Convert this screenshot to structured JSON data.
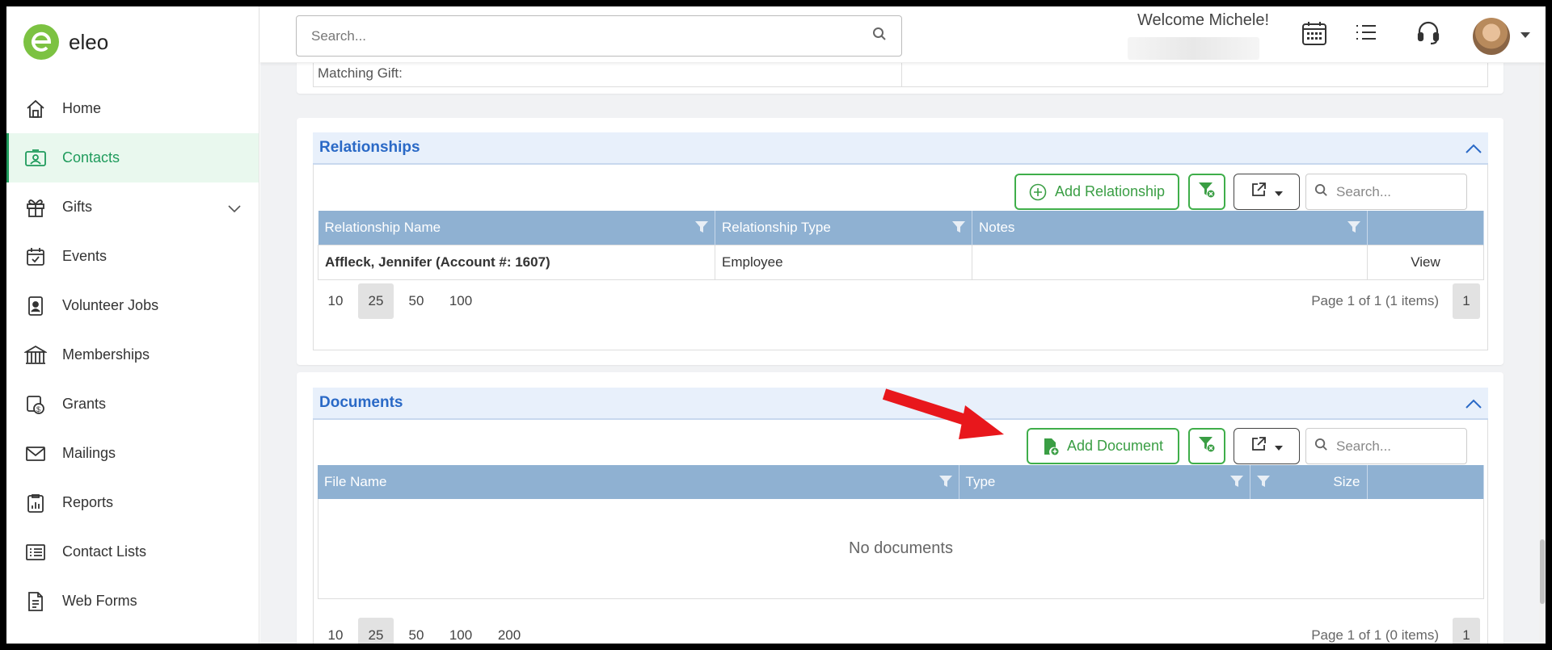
{
  "app": {
    "name": "eleo"
  },
  "colors": {
    "brand_green": "#7cc242",
    "active_green": "#1f9b5c",
    "header_blue": "#2a69c6",
    "grid_header": "#8fb1d2",
    "annotation_red": "#e8171c"
  },
  "sidebar": {
    "items": [
      {
        "label": "Home",
        "icon": "home-icon"
      },
      {
        "label": "Contacts",
        "icon": "contact-card-icon",
        "active": true
      },
      {
        "label": "Gifts",
        "icon": "gift-icon",
        "expandable": true
      },
      {
        "label": "Events",
        "icon": "calendar-check-icon"
      },
      {
        "label": "Volunteer Jobs",
        "icon": "badge-icon"
      },
      {
        "label": "Memberships",
        "icon": "building-icon"
      },
      {
        "label": "Grants",
        "icon": "grant-dollar-icon"
      },
      {
        "label": "Mailings",
        "icon": "envelope-icon"
      },
      {
        "label": "Reports",
        "icon": "report-chart-icon"
      },
      {
        "label": "Contact Lists",
        "icon": "list-icon"
      },
      {
        "label": "Web Forms",
        "icon": "form-icon"
      }
    ]
  },
  "topbar": {
    "search_placeholder": "Search...",
    "welcome": "Welcome Michele!",
    "icons": [
      "calendar-grid-icon",
      "task-list-icon",
      "headset-icon",
      "avatar",
      "chevron-down-icon"
    ]
  },
  "matching_gift": {
    "label": "Matching Gift:"
  },
  "relationships": {
    "title": "Relationships",
    "add_button": "Add Relationship",
    "search_placeholder": "Search...",
    "columns": [
      "Relationship Name",
      "Relationship Type",
      "Notes",
      ""
    ],
    "rows": [
      {
        "name": "Affleck, Jennifer (Account #: 1607)",
        "type": "Employee",
        "notes": "",
        "action": "View"
      }
    ],
    "page_sizes": [
      "10",
      "25",
      "50",
      "100"
    ],
    "selected_page_size": "25",
    "pager_info": "Page 1 of 1 (1 items)",
    "current_page": "1"
  },
  "documents": {
    "title": "Documents",
    "add_button": "Add Document",
    "search_placeholder": "Search...",
    "columns": [
      "File Name",
      "Type",
      "Size",
      ""
    ],
    "empty_text": "No documents",
    "page_sizes": [
      "10",
      "25",
      "50",
      "100",
      "200"
    ],
    "selected_page_size": "25",
    "pager_info": "Page 1 of 1 (0 items)",
    "current_page": "1"
  }
}
